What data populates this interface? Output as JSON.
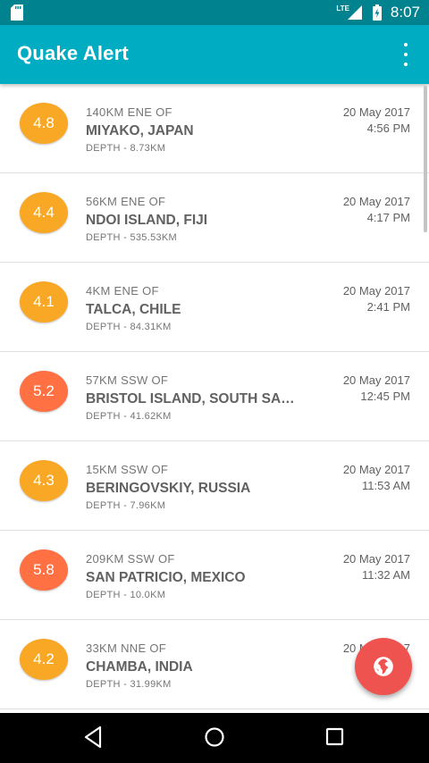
{
  "status_bar": {
    "sd_icon": "sd-card-icon",
    "network": "LTE",
    "time": "8:07"
  },
  "app_bar": {
    "title": "Quake Alert",
    "menu_icon": "more-vert-icon"
  },
  "quakes": [
    {
      "magnitude": "4.8",
      "offset": "140KM ENE OF",
      "place": "MIYAKO, JAPAN",
      "depth": "DEPTH - 8.73KM",
      "date": "20 May 2017",
      "time": "4:56 PM",
      "color": "#f9a825"
    },
    {
      "magnitude": "4.4",
      "offset": "56KM ENE OF",
      "place": "NDOI ISLAND, FIJI",
      "depth": "DEPTH - 535.53KM",
      "date": "20 May 2017",
      "time": "4:17 PM",
      "color": "#f9a825"
    },
    {
      "magnitude": "4.1",
      "offset": "4KM ENE OF",
      "place": "TALCA, CHILE",
      "depth": "DEPTH - 84.31KM",
      "date": "20 May 2017",
      "time": "2:41 PM",
      "color": "#f9a825"
    },
    {
      "magnitude": "5.2",
      "offset": "57KM SSW OF",
      "place": "BRISTOL ISLAND, SOUTH SAN…",
      "depth": "DEPTH - 41.62KM",
      "date": "20 May 2017",
      "time": "12:45 PM",
      "color": "#ff7043"
    },
    {
      "magnitude": "4.3",
      "offset": "15KM SSW OF",
      "place": "BERINGOVSKIY, RUSSIA",
      "depth": "DEPTH - 7.96KM",
      "date": "20 May 2017",
      "time": "11:53 AM",
      "color": "#f9a825"
    },
    {
      "magnitude": "5.8",
      "offset": "209KM SSW OF",
      "place": "SAN PATRICIO, MEXICO",
      "depth": "DEPTH - 10.0KM",
      "date": "20 May 2017",
      "time": "11:32 AM",
      "color": "#ff7043"
    },
    {
      "magnitude": "4.2",
      "offset": "33KM NNE OF",
      "place": "CHAMBA, INDIA",
      "depth": "DEPTH - 31.99KM",
      "date": "20 May 2017",
      "time": "",
      "color": "#f9a825"
    }
  ],
  "fab": {
    "icon": "globe-icon",
    "color": "#ef5350"
  },
  "nav_bar": {
    "back_icon": "back-triangle-icon",
    "home_icon": "home-circle-icon",
    "recents_icon": "recents-square-icon"
  },
  "colors": {
    "status_bar": "#00838f",
    "app_bar": "#00acc1"
  }
}
